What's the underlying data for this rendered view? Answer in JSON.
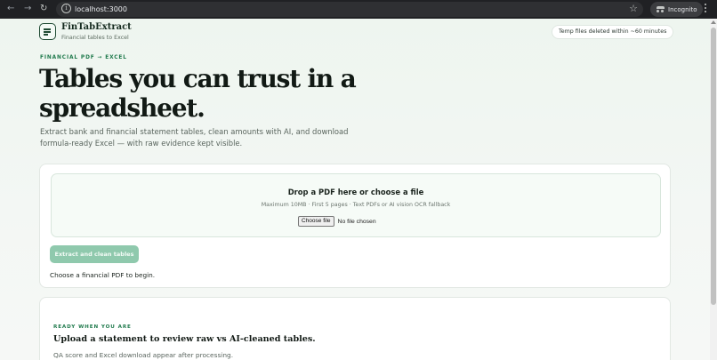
{
  "browser": {
    "url": "localhost:3000",
    "incognito_label": "Incognito",
    "icons": [
      "back-arrow-icon",
      "forward-arrow-icon",
      "reload-icon",
      "site-info-icon",
      "bookmark-star-icon",
      "incognito-icon",
      "menu-kebab-icon"
    ]
  },
  "header": {
    "brand": "FinTabExtract",
    "tagline": "Financial tables to Excel",
    "temp_badge": "Temp files deleted within ~60 minutes"
  },
  "hero": {
    "eyebrow": "FINANCIAL PDF → EXCEL",
    "title": "Tables you can trust in a spreadsheet.",
    "subtitle": "Extract bank and financial statement tables, clean amounts with AI, and download formula-ready Excel — with raw evidence kept visible."
  },
  "upload": {
    "drop_title": "Drop a PDF here or choose a file",
    "drop_hint": "Maximum 10MB · First 5 pages · Text PDFs or AI vision OCR fallback",
    "choose_file_label": "Choose file",
    "file_status": "No file chosen",
    "extract_label": "Extract and clean tables",
    "status_text": "Choose a financial PDF to begin."
  },
  "ready": {
    "eyebrow": "READY WHEN YOU ARE",
    "title": "Upload a statement to review raw vs AI-cleaned tables.",
    "subtitle": "QA score and Excel download appear after processing."
  },
  "colors": {
    "accent_green": "#1f7a4c",
    "button_disabled": "#8fc9ad",
    "heading": "#121a15"
  }
}
